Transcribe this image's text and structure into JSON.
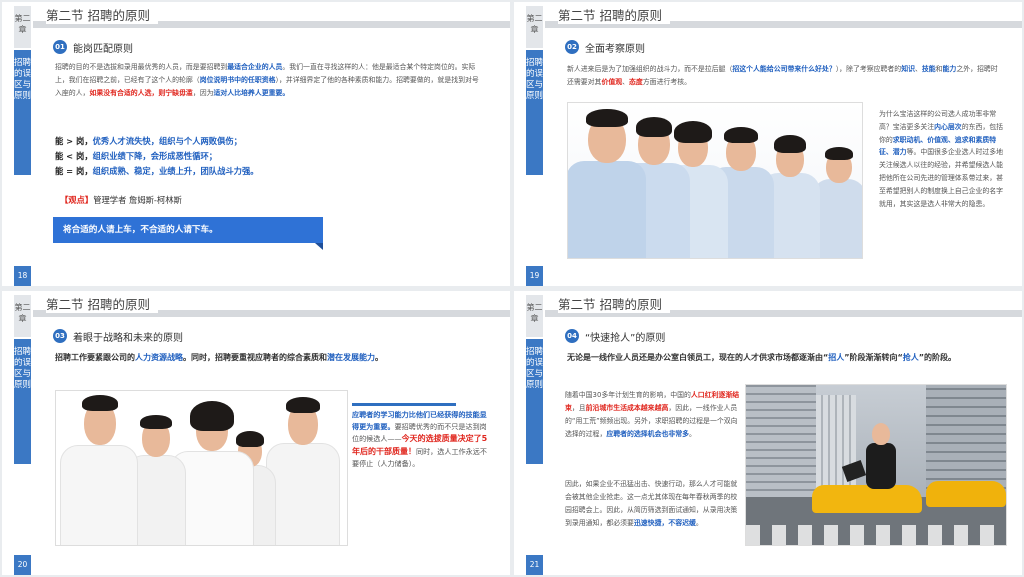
{
  "slides": [
    {
      "title": "第二节  招聘的原则",
      "chapter_tab": "第二章",
      "sidebar_label": "招聘的误区与原则",
      "page_number": "18",
      "section_num": "01",
      "section_heading": "能岗匹配原则",
      "para_parts": [
        "招聘的目的不是选拔和录用最优秀的人员，而是要招聘到",
        "最适合企业的人员",
        "。我们一直在寻找这样的人：他是最适合某个特定岗位的。实际上，我们在招聘之前，已经有了这个人的轮廓（",
        "岗位说明书中的任职资格",
        "），并详细界定了他的各种素质和能力。招聘要做的，就是找到对号入座的人，",
        "如果没有合适的人选，则宁缺毋滥",
        "，因为",
        "适对人比培养人更重要。"
      ],
      "abilities": [
        {
          "prefix": "能 > 岗，",
          "text": "优秀人才流失快，组织与个人两败俱伤；"
        },
        {
          "prefix": "能 < 岗，",
          "text": "组织业绩下降，会形成恶性循环；"
        },
        {
          "prefix": "能 = 岗，",
          "text": "组织成熟、稳定，业绩上升，团队战斗力强。"
        }
      ],
      "viewpoint_tag": "【观点】",
      "viewpoint_text": "管理学者 詹姆斯-柯林斯",
      "callout": "将合适的人请上车，不合适的人请下车。"
    },
    {
      "title": "第二节  招聘的原则",
      "chapter_tab": "第二章",
      "sidebar_label": "招聘的误区与原则",
      "page_number": "19",
      "section_num": "02",
      "section_heading": "全面考察原则",
      "para_parts": [
        "新人进来后是为了加强组织的战斗力，而不是拉后腿（",
        "招这个人能给公司带来什么好处？",
        "），除了考察应聘者的",
        "知识",
        "、",
        "技能",
        "和",
        "能力",
        "之外，招聘时还需要对其",
        "价值观",
        "、",
        "态度",
        "方面进行考核。"
      ],
      "side_parts": [
        "为什么宝洁这样的公司选人成功率非常高？宝洁更多关注",
        "内心层次",
        "的东西，包括你的",
        "求职动机、价值观、追求和素质特征、潜力",
        "等。中国很多企业选人时过多地关注候选人以往的经验，并希望候选人能把他所在公司先进的管理体系带过来，甚至希望把别人的制度换上自己企业的名字就用，其实这是选人非常大的隐患。"
      ]
    },
    {
      "title": "第二节  招聘的原则",
      "chapter_tab": "第二章",
      "sidebar_label": "招聘的误区与原则",
      "page_number": "20",
      "section_num": "03",
      "section_heading": "着眼于战略和未来的原则",
      "para_parts": [
        "招聘工作要紧跟公司的",
        "人力资源战略",
        "。同时，招聘要重视应聘者的综合素质和",
        "潜在发展能力",
        "。"
      ],
      "box_parts": [
        "应聘者的学习能力比他们已经获得的技能显得更为重要。",
        "要招聘优秀的而不只是达到岗位的候选人——",
        "今天的选拔质量决定了5年后的干部质量！",
        "同时，选人工作永远不要停止（人力储备）。"
      ]
    },
    {
      "title": "第二节  招聘的原则",
      "chapter_tab": "第二章",
      "sidebar_label": "招聘的误区与原则",
      "page_number": "21",
      "section_num": "04",
      "section_heading": "“快速抢人”的原则",
      "lead_parts": [
        "无论是一线作业人员还是办公室白领员工，现在的人才供求市场都逐渐由“",
        "招人",
        "”阶段渐渐转向“",
        "抢人",
        "”的阶段。"
      ],
      "para_a_parts": [
        "随着中国30多年计划生育的影响，中国的",
        "人口红利逐渐结束",
        "，且",
        "前沿城市生活成本越来越高",
        "，因此，一线作业人员的“用工荒”频频出现。另外，求职招聘的过程是一个双向选择的过程，",
        "应聘者的选择机会也非常多",
        "。"
      ],
      "para_b_parts": [
        "因此，如果企业不迅猛出击、快速行动，那么人才可能就会被其他企业抢走。这一点尤其体现在每年春秋两季的校园招聘会上。因此，从简历筛选到面试通知，从录用决策到录用通知，都必须要",
        "迅速快捷，不容迟缓",
        "。"
      ]
    }
  ],
  "colors": {
    "accent_blue": "#2f6fc0",
    "emphasis_red": "#e0261e",
    "sidebar_blue": "#3b78c4"
  }
}
